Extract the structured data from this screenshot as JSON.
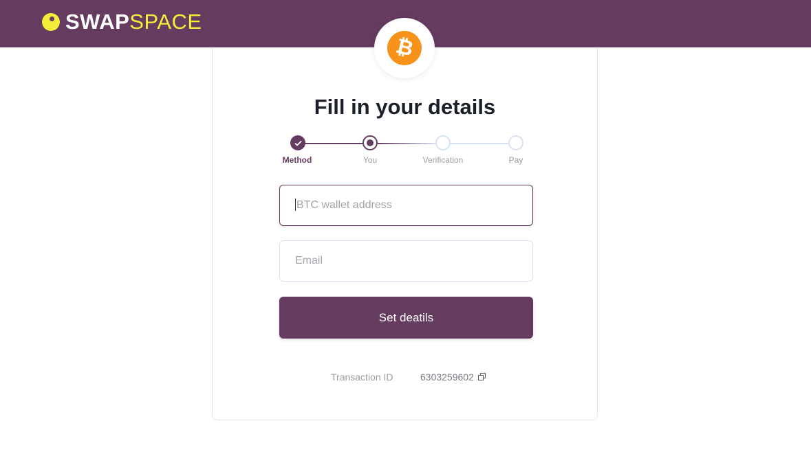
{
  "header": {
    "brand_swap": "SWAP",
    "brand_space": "SPACE",
    "brand_color": "#653b5f",
    "accent_color": "#f5ee3a"
  },
  "coin": {
    "icon": "bitcoin-icon",
    "symbol": "₿",
    "color": "#f7931a"
  },
  "form": {
    "title": "Fill in your details",
    "steps": [
      {
        "label": "Method",
        "state": "completed"
      },
      {
        "label": "You",
        "state": "current"
      },
      {
        "label": "Verification",
        "state": "pending"
      },
      {
        "label": "Pay",
        "state": "pending"
      }
    ],
    "wallet_placeholder": "BTC wallet address",
    "email_placeholder": "Email",
    "submit_label": "Set deatils",
    "transaction_label": "Transaction ID",
    "transaction_id": "6303259602"
  }
}
